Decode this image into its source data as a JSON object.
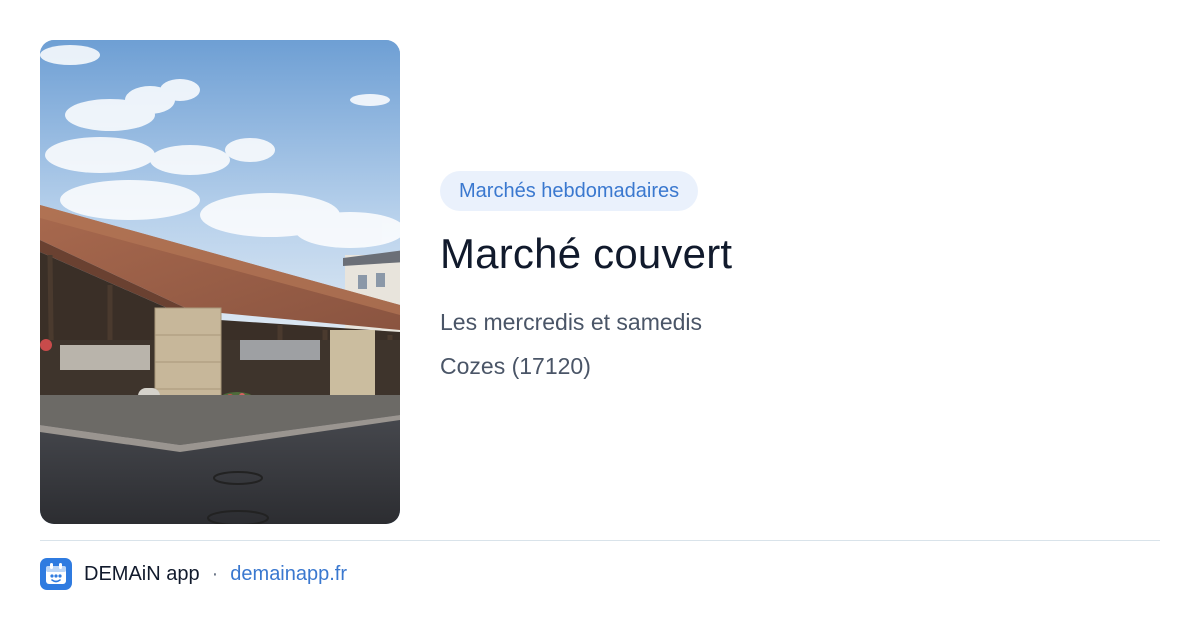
{
  "card": {
    "image_alt": "Marché couvert photo",
    "category": "Marchés hebdomadaires",
    "title": "Marché couvert",
    "schedule": "Les mercredis et samedis",
    "location": "Cozes (17120)"
  },
  "footer": {
    "icon": "calendar-icon",
    "app_name": "DEMAiN app",
    "separator": "·",
    "link_text": "demainapp.fr"
  },
  "colors": {
    "accent": "#3a78cf",
    "tag_background": "#eaf1fc",
    "title": "#111a2c",
    "secondary_text": "#4a5567",
    "app_icon_background": "#2f7be0"
  }
}
